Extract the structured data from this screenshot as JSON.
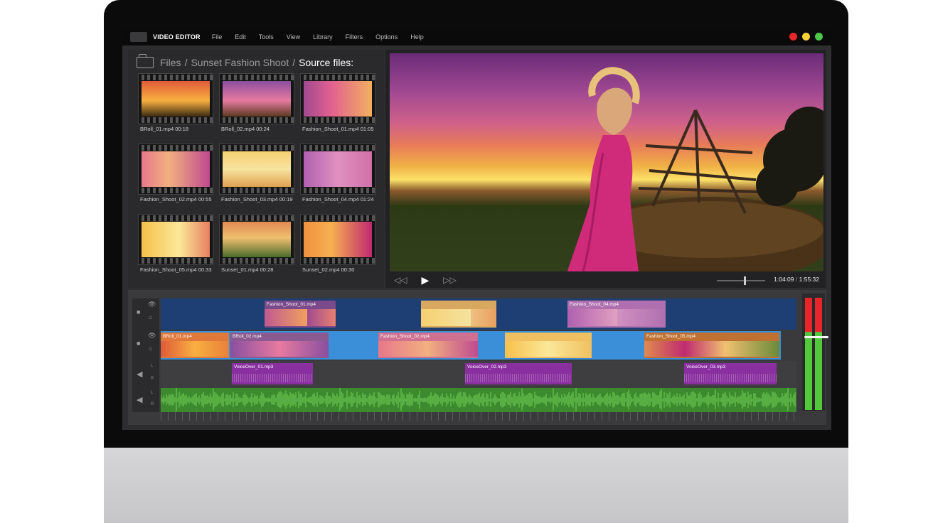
{
  "app": {
    "name": "VIDEO EDITOR"
  },
  "menu": [
    "File",
    "Edit",
    "Tools",
    "View",
    "Library",
    "Filters",
    "Options",
    "Help"
  ],
  "window_controls": {
    "colors": [
      "#e8262a",
      "#f5d232",
      "#4ec84a"
    ]
  },
  "breadcrumb": {
    "parts": [
      "Files",
      "Sunset Fashion Shoot"
    ],
    "current": "Source files:"
  },
  "source_files": [
    {
      "name": "BRoll_01.mp4",
      "duration": "00:18"
    },
    {
      "name": "BRoll_02.mp4",
      "duration": "00:24"
    },
    {
      "name": "Fashion_Shoot_01.mp4",
      "duration": "01:05"
    },
    {
      "name": "Fashion_Shoot_02.mp4",
      "duration": "00:55"
    },
    {
      "name": "Fashion_Shoot_03.mp4",
      "duration": "00:19"
    },
    {
      "name": "Fashion_Shoot_04.mp4",
      "duration": "01:24"
    },
    {
      "name": "Fashion_Shoot_05.mp4",
      "duration": "00:33"
    },
    {
      "name": "Sunset_01.mp4",
      "duration": "00:28"
    },
    {
      "name": "Sunset_02.mp4",
      "duration": "00:30"
    }
  ],
  "viewer": {
    "current_time": "1:04:09",
    "total_time": "1:55:32",
    "separator": "/",
    "volume_level": 0.58
  },
  "tracks": {
    "video_top": [
      {
        "label": "Fashion_Shoot_01.mp4"
      },
      {
        "label": ""
      },
      {
        "label": "Fashion_Shoot_04.mp4"
      }
    ],
    "video_bottom": [
      {
        "label": "BRoll_01.mp4"
      },
      {
        "label": "BRoll_02.mp4"
      },
      {
        "label": "Fashion_Shoot_02.mp4"
      },
      {
        "label": ""
      },
      {
        "label": "Fashion_Shoot_05.mp4"
      }
    ],
    "voice": [
      "VoiceOver_01.mp3",
      "VoiceOver_02.mp3",
      "VoiceOver_03.mp3"
    ],
    "channel_labels": {
      "left": "L",
      "right": "R"
    }
  },
  "colors": {
    "video_track": "#1e3f73",
    "video_track_alt": "#3a8fd8",
    "voice_clip": "#8a2fa0",
    "music_track": "#3c8a2e"
  }
}
